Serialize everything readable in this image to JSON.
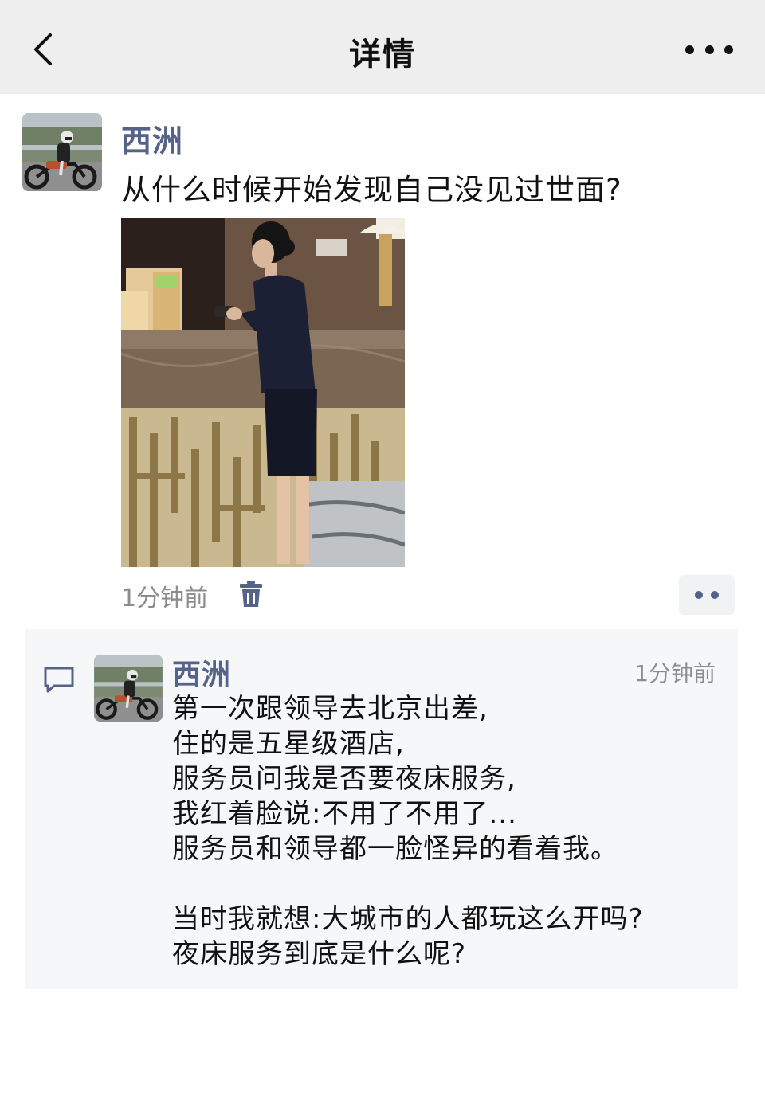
{
  "nav": {
    "title": "详情",
    "back_icon": "chevron-left-icon",
    "more_icon": "more-horizontal-icon"
  },
  "post": {
    "author": "西洲",
    "text": "从什么时候开始发现自己没见过世面?",
    "photo_description_icon": "hotel-reception-photo",
    "time": "1分钟前",
    "delete_icon": "trash-icon",
    "actions_icon": "two-dots-icon"
  },
  "comment": {
    "icon": "comment-bubble-icon",
    "author": "西洲",
    "time": "1分钟前",
    "paragraphs": [
      [
        "第一次跟领导去北京出差,",
        "住的是五星级酒店,",
        "服务员问我是否要夜床服务,",
        "我红着脸说:不用了不用了...",
        "服务员和领导都一脸怪异的看着我。"
      ],
      [
        "当时我就想:大城市的人都玩这么开吗?",
        "夜床服务到底是什么呢?"
      ]
    ]
  },
  "colors": {
    "nav_bg": "#eeeeee",
    "name_link": "#55628a",
    "muted_text": "#8c8c8c",
    "comment_panel_bg": "#f6f7f9"
  }
}
